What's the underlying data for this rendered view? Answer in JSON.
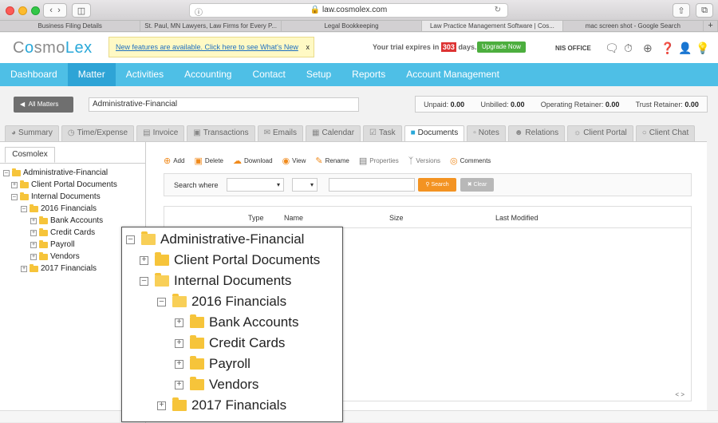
{
  "browser": {
    "url": "law.cosmolex.com",
    "tabs": [
      "Business Filing Details",
      "St. Paul, MN Lawyers, Law Firms for Every P...",
      "Legal Bookkeeping",
      "Law Practice Management Software | Cos...",
      "mac screen shot - Google Search",
      "+"
    ],
    "active_tab": 3
  },
  "header": {
    "logo_prefix": "C",
    "logo_o": "o",
    "logo_mid": "smo",
    "logo_suffix": "Lex",
    "notice": "New features are available. Click here to see What's New",
    "notice_close": "x",
    "trial_prefix": "Your trial expires in",
    "trial_days": "303",
    "trial_suffix": "days.",
    "upgrade": "Upgrade Now",
    "office": "NIS OFFICE"
  },
  "nav": [
    "Dashboard",
    "Matter",
    "Activities",
    "Accounting",
    "Contact",
    "Setup",
    "Reports",
    "Account Management"
  ],
  "nav_active": 1,
  "matter": {
    "all_matters": "All Matters",
    "name": "Administrative-Financial",
    "unpaid_label": "Unpaid:",
    "unpaid": "0.00",
    "unbilled_label": "Unbilled:",
    "unbilled": "0.00",
    "op_label": "Operating Retainer:",
    "op": "0.00",
    "trust_label": "Trust Retainer:",
    "trust": "0.00"
  },
  "subtabs": [
    "Summary",
    "Time/Expense",
    "Invoice",
    "Transactions",
    "Emails",
    "Calendar",
    "Task",
    "Documents",
    "Notes",
    "Relations",
    "Client Portal",
    "Client Chat"
  ],
  "subtab_active": 7,
  "left_panel": {
    "tab": "Cosmolex",
    "tree": {
      "root": "Administrative-Financial",
      "client_portal": "Client Portal Documents",
      "internal": "Internal Documents",
      "fin2016": "2016 Financials",
      "bank": "Bank Accounts",
      "credit": "Credit Cards",
      "payroll": "Payroll",
      "vendors": "Vendors",
      "fin2017": "2017 Financials"
    }
  },
  "toolbar": {
    "add": "Add",
    "delete": "Delete",
    "download": "Download",
    "view": "View",
    "rename": "Rename",
    "properties": "Properties",
    "versions": "Versions",
    "comments": "Comments"
  },
  "search": {
    "label": "Search where",
    "search_btn": "Search",
    "clear_btn": "Clear"
  },
  "grid": {
    "type": "Type",
    "name": "Name",
    "size": "Size",
    "last_modified": "Last Modified"
  }
}
